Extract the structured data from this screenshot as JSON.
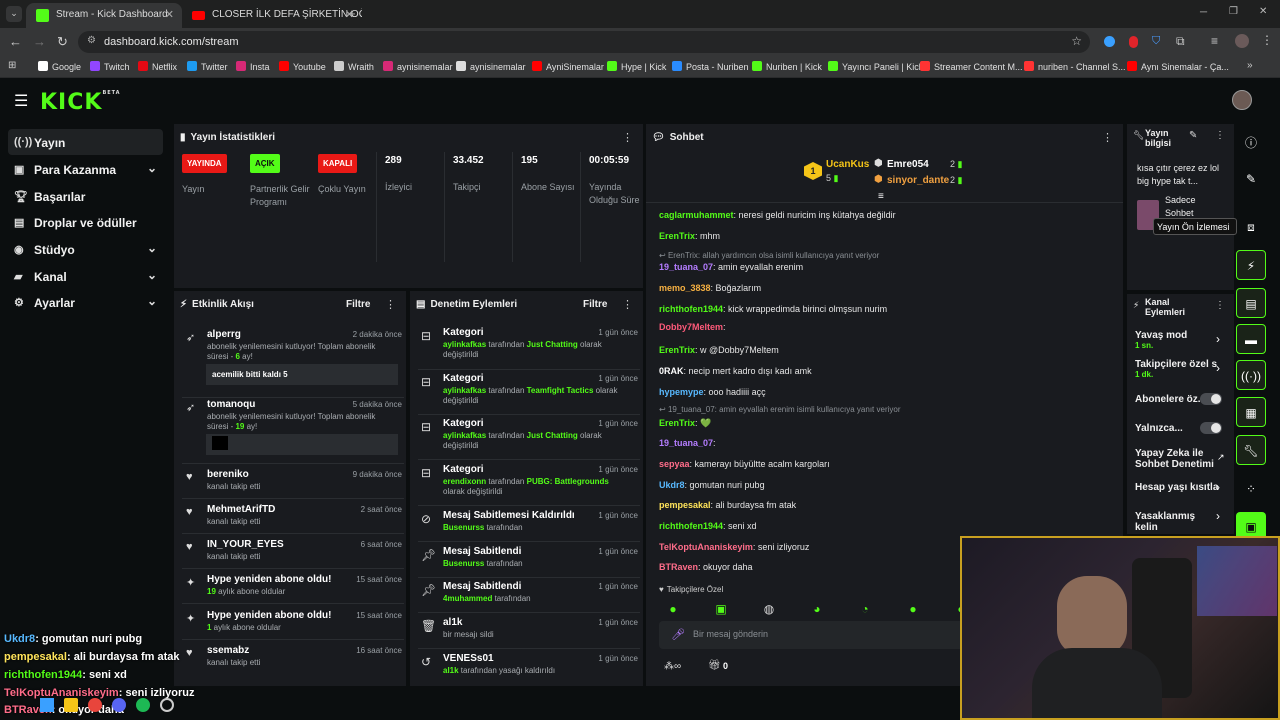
{
  "browser": {
    "tabs": [
      {
        "title": "Stream - Kick Dashboard",
        "active": true
      },
      {
        "title": "CLOSER İLK DEFA ŞİRKETİN OĞ",
        "active": false
      }
    ],
    "url": "dashboard.kick.com/stream",
    "bookmarks": [
      "Google",
      "Twitch",
      "Netflix",
      "Twitter",
      "Insta",
      "Youtube",
      "Wraith",
      "aynisinemalar",
      "aynisinemalar",
      "AyniSinemalar",
      "Hype | Kick",
      "Posta - Nuriben",
      "Nuriben | Kick",
      "Yayıncı Paneli | Kick",
      "Streamer Content M...",
      "nuriben - Channel S...",
      "Aynı Sinemalar - Ça..."
    ]
  },
  "header": {
    "logo": "KICK",
    "logo_beta": "BETA"
  },
  "sidebar": {
    "items": [
      {
        "label": "Yayın",
        "icon": "broadcast-icon"
      },
      {
        "label": "Para Kazanma",
        "icon": "money-icon"
      },
      {
        "label": "Başarılar",
        "icon": "trophy-icon"
      },
      {
        "label": "Droplar ve ödüller",
        "icon": "gift-icon"
      },
      {
        "label": "Stüdyo",
        "icon": "studio-icon"
      },
      {
        "label": "Kanal",
        "icon": "channel-icon"
      },
      {
        "label": "Ayarlar",
        "icon": "gear-icon"
      }
    ]
  },
  "stats": {
    "title": "Yayın İstatistikleri",
    "badges": [
      {
        "badge": "YAYINDA",
        "label": "Yayın",
        "color": "#e91916"
      },
      {
        "badge": "AÇIK",
        "label": "Partnerlik Gelir Programı",
        "color": "#53fc18"
      },
      {
        "badge": "KAPALI",
        "label": "Çoklu Yayın",
        "color": "#e91916"
      }
    ],
    "numbers": [
      {
        "value": "289",
        "label": "İzleyici"
      },
      {
        "value": "33.452",
        "label": "Takipçi"
      },
      {
        "value": "195",
        "label": "Abone Sayısı"
      },
      {
        "value": "00:05:59",
        "label": "Yayında Olduğu Süre"
      }
    ]
  },
  "activity": {
    "title": "Etkinlik Akışı",
    "filter": "Filtre",
    "events": [
      {
        "name": "alperrg",
        "time": "2 dakika önce",
        "pre": "abonelik yenilemesini kutluyor! Toplam abonelik süresi - ",
        "hl": "6",
        "post": " ay!",
        "message": "acemilik bitti kaldı 5"
      },
      {
        "name": "tomanoqu",
        "time": "5 dakika önce",
        "pre": "abonelik yenilemesini kutluyor! Toplam abonelik süresi - ",
        "hl": "19",
        "post": " ay!",
        "message": ""
      },
      {
        "name": "bereniko",
        "time": "9 dakika önce",
        "desc": "kanalı takip etti"
      },
      {
        "name": "MehmetArifTD",
        "time": "2 saat önce",
        "desc": "kanalı takip etti"
      },
      {
        "name": "IN_YOUR_EYES",
        "time": "6 saat önce",
        "desc": "kanalı takip etti"
      },
      {
        "name": "Hype yeniden abone oldu!",
        "time": "15 saat önce",
        "hl": "19",
        "post": " aylık abone oldular"
      },
      {
        "name": "Hype yeniden abone oldu!",
        "time": "15 saat önce",
        "hl": "1",
        "post": " aylık abone oldular"
      },
      {
        "name": "ssemabz",
        "time": "16 saat önce",
        "desc": "kanalı takip etti"
      }
    ]
  },
  "moderation": {
    "title": "Denetim Eylemleri",
    "filter": "Filtre",
    "actions": [
      {
        "title": "Kategori",
        "time": "1 gün önce",
        "user": "aylinkafkas",
        "mid": " tarafından ",
        "target": "Just Chatting",
        "post": " olarak değiştirildi"
      },
      {
        "title": "Kategori",
        "time": "1 gün önce",
        "user": "aylinkafkas",
        "mid": " tarafından ",
        "target": "Teamfight Tactics",
        "post": " olarak değiştirildi"
      },
      {
        "title": "Kategori",
        "time": "1 gün önce",
        "user": "aylinkafkas",
        "mid": " tarafından ",
        "target": "Just Chatting",
        "post": " olarak değiştirildi"
      },
      {
        "title": "Kategori",
        "time": "1 gün önce",
        "user": "erendixonn",
        "mid": " tarafından ",
        "target": "PUBG: Battlegrounds",
        "post": " olarak değiştirildi"
      },
      {
        "title": "Mesaj Sabitlemesi Kaldırıldı",
        "time": "1 gün önce",
        "user": "Busenurss",
        "mid": " tarafından",
        "target": "",
        "post": ""
      },
      {
        "title": "Mesaj Sabitlendi",
        "time": "1 gün önce",
        "user": "Busenurss",
        "mid": " tarafından",
        "target": "",
        "post": ""
      },
      {
        "title": "Mesaj Sabitlendi",
        "time": "1 gün önce",
        "user": "4muhammed",
        "mid": " tarafından",
        "target": "",
        "post": ""
      },
      {
        "title": "al1k",
        "time": "1 gün önce",
        "user": "",
        "mid": "bir mesajı sildi",
        "target": "",
        "post": ""
      },
      {
        "title": "VENESs01",
        "time": "1 gün önce",
        "user": "al1k",
        "mid": " tarafından yasağı kaldırıldı",
        "target": "",
        "post": ""
      }
    ]
  },
  "chat": {
    "title": "Sohbet",
    "top_gifters": [
      {
        "name": "UcanKus",
        "count": "5",
        "color": "#f5c518"
      },
      {
        "name": "Emre054",
        "count": "2",
        "color": "#ffffff"
      },
      {
        "name": "sinyor_dante",
        "count": "2",
        "color": "#f0a040"
      }
    ],
    "rank": "1",
    "messages": [
      {
        "user": "caglarmuhammet",
        "color": "#53fc18",
        "text": ": neresi geldi nuricim inş kütahya değildir"
      },
      {
        "user": "ErenTrix",
        "color": "#53fc18",
        "text": ": mhm"
      },
      {
        "reply": "ErenTrix: allah yardımcın olsa isimli kullanıcıya yanıt veriyor"
      },
      {
        "user": "19_tuana_07",
        "color": "#b57dff",
        "text": ": amin eyvallah erenim"
      },
      {
        "user": "memo_3838",
        "color": "#f5b042",
        "text": ": Boğazlarım"
      },
      {
        "user": "richthofen1944",
        "color": "#53fc18",
        "text": ": kick wrappedimda birinci olmşsun nurim"
      },
      {
        "user": "Dobby7Meltem",
        "color": "#ff5a7a",
        "text": ":"
      },
      {
        "user": "ErenTrix",
        "color": "#53fc18",
        "text": ": w @Dobby7Meltem"
      },
      {
        "user": "0RAK",
        "color": "#ffffff",
        "text": ": necip mert kadro dışı kadı amk"
      },
      {
        "user": "hypemype",
        "color": "#58b9ff",
        "text": ": ooo hadiiii açç"
      },
      {
        "reply": "19_tuana_07: amin eyvallah erenim isimli kullanıcıya yanıt veriyor"
      },
      {
        "user": "ErenTrix",
        "color": "#53fc18",
        "text": ": 💚"
      },
      {
        "user": "19_tuana_07",
        "color": "#b57dff",
        "text": ":"
      },
      {
        "user": "sepyaa",
        "color": "#ff6d8a",
        "text": ": kamerayı büyültte acalm kargoları"
      },
      {
        "user": "Ukdr8",
        "color": "#58b9ff",
        "text": ": gomutan nuri pubg"
      },
      {
        "user": "pempesakal",
        "color": "#ffe45a",
        "text": ": ali burdaysa fm atak"
      },
      {
        "user": "richthofen1944",
        "color": "#53fc18",
        "text": ": seni xd"
      },
      {
        "user": "TelKoptuAnaniskeyim",
        "color": "#ff6d8a",
        "text": ": seni izliyoruz"
      },
      {
        "user": "BTRaven",
        "color": "#ff6d8a",
        "text": ": okuyor daha"
      }
    ],
    "followers_only": "Takipçilere Özel",
    "input_placeholder": "Bir mesaj gönderin",
    "footer_count": "0"
  },
  "stream_info": {
    "title": "Yayın bilgisi",
    "text": "kısa çıtır çerez ez lol big hype tak t...",
    "category": "Sadece Sohbet",
    "tooltip": "Yayın Ön İzlemesi"
  },
  "channel_actions": {
    "title": "Kanal Eylemleri",
    "items": [
      {
        "label": "Yavaş mod",
        "sub": "1 sn.",
        "type": "chevron"
      },
      {
        "label": "Takipçilere özel s",
        "sub": "1 dk.",
        "type": "chevron"
      },
      {
        "label": "Abonelere öz...",
        "sub": "",
        "type": "toggle"
      },
      {
        "label": "Yalnızca...",
        "sub": "",
        "type": "toggle"
      },
      {
        "label": "Yapay Zeka ile Sohbet Denetimi",
        "sub": "",
        "type": "link"
      },
      {
        "label": "Hesap yaşı kısıtla",
        "sub": "",
        "type": "chevron"
      },
      {
        "label": "Yasaklanmış kelin",
        "sub": "",
        "type": "chevron"
      }
    ]
  },
  "overlay_chat": [
    {
      "user": "Ukdr8",
      "color": "#58b9ff",
      "text": ": gomutan nuri pubg"
    },
    {
      "user": "pempesakal",
      "color": "#ffe45a",
      "text": ": ali burdaysa fm atak"
    },
    {
      "user": "richthofen1944",
      "color": "#53fc18",
      "text": ": seni xd"
    },
    {
      "user": "TelKoptuAnaniskeyim",
      "color": "#ff6d8a",
      "text": ": seni izliyoruz"
    },
    {
      "user": "BTRaven",
      "color": "#ff6d8a",
      "text": ": okuyor daha"
    }
  ],
  "colors": {
    "accent": "#53fc18",
    "live": "#e91916",
    "panel": "#191b1f",
    "bg": "#0b0e0f"
  }
}
